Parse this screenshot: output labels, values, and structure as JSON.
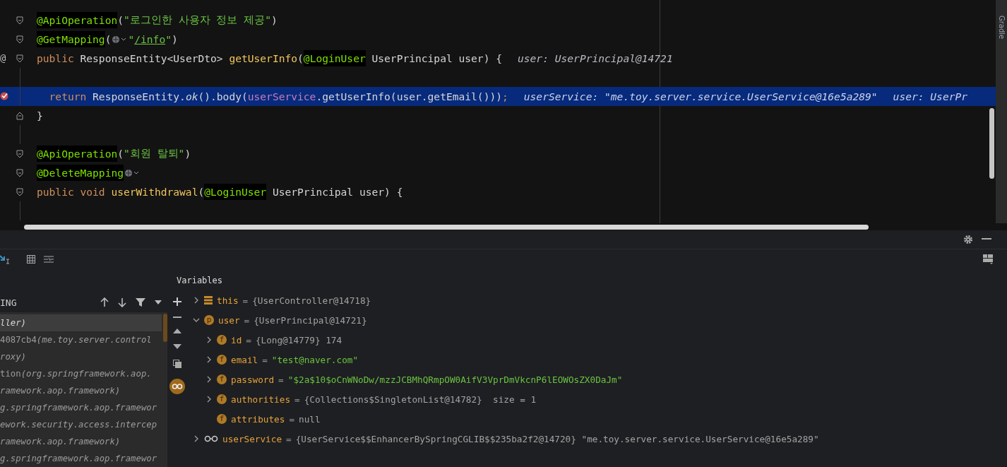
{
  "editor": {
    "lines": [
      {
        "kind": "start",
        "tokens": [
          {
            "kind": "annotation",
            "text": "@ApiOperation"
          },
          {
            "kind": "plain",
            "text": "("
          },
          {
            "kind": "string",
            "text": "\"로그인한 사용자 정보 제공\""
          },
          {
            "kind": "plain",
            "text": ")"
          }
        ]
      },
      {
        "kind": "start",
        "tokens": [
          {
            "kind": "annotation",
            "text": "@GetMapping"
          },
          {
            "kind": "plain",
            "text": "("
          },
          {
            "kind": "globe"
          },
          {
            "kind": "string",
            "text": "\""
          },
          {
            "kind": "link",
            "text": "/info"
          },
          {
            "kind": "string",
            "text": "\""
          },
          {
            "kind": "plain",
            "text": ")"
          }
        ]
      },
      {
        "kind": "start",
        "gutter_text": "@",
        "tokens": [
          {
            "kind": "keyword",
            "text": "public "
          },
          {
            "kind": "plain",
            "text": "ResponseEntity<UserDto> "
          },
          {
            "kind": "method",
            "text": "getUserInfo"
          },
          {
            "kind": "plain",
            "text": "("
          },
          {
            "kind": "annotation",
            "text": "@LoginUser"
          },
          {
            "kind": "plain",
            "text": " UserPrincipal user) {"
          },
          {
            "kind": "hint",
            "text": "user: UserPrincipal@14721"
          }
        ]
      },
      {
        "kind": "body"
      },
      {
        "kind": "body",
        "current": true,
        "breakpoint": true,
        "tokens": [
          {
            "kind": "keyword",
            "text": "  return "
          },
          {
            "kind": "plain",
            "text": "ResponseEntity."
          },
          {
            "kind": "static",
            "text": "ok"
          },
          {
            "kind": "plain",
            "text": "().body("
          },
          {
            "kind": "field",
            "text": "userService"
          },
          {
            "kind": "plain",
            "text": ".getUserInfo(user.getEmail()))"
          },
          {
            "kind": "semicolon",
            "text": ";"
          },
          {
            "kind": "hint",
            "text": "userService: \"me.toy.server.service.UserService@16e5a289\""
          },
          {
            "kind": "hint",
            "text": "user: UserPr"
          }
        ]
      },
      {
        "kind": "end",
        "tokens": [
          {
            "kind": "plain",
            "text": "}"
          }
        ]
      },
      {
        "kind": "body"
      },
      {
        "kind": "start",
        "tokens": [
          {
            "kind": "annotation",
            "text": "@ApiOperation"
          },
          {
            "kind": "plain",
            "text": "("
          },
          {
            "kind": "string",
            "text": "\"회원 탈퇴\""
          },
          {
            "kind": "plain",
            "text": ")"
          }
        ]
      },
      {
        "kind": "start",
        "tokens": [
          {
            "kind": "annotation",
            "text": "@DeleteMapping"
          },
          {
            "kind": "globe"
          }
        ]
      },
      {
        "kind": "start",
        "tokens": [
          {
            "kind": "keyword",
            "text": "public void "
          },
          {
            "kind": "method",
            "text": "userWithdrawal"
          },
          {
            "kind": "plain",
            "text": "("
          },
          {
            "kind": "annotation",
            "text": "@LoginUser"
          },
          {
            "kind": "plain",
            "text": " UserPrincipal user) {"
          }
        ]
      },
      {
        "kind": "body"
      }
    ]
  },
  "side_strip": {
    "label": "Gradle"
  },
  "frames": {
    "header": "ING",
    "items": [
      {
        "location": "ller)",
        "selected": true
      },
      {
        "name": "4087cb4",
        "location": "(me.toy.server.control",
        "selected": false
      },
      {
        "location": "roxy)",
        "selected": false
      },
      {
        "name": "tion",
        "location": "(org.springframework.aop.",
        "selected": false
      },
      {
        "location": "ramework.aop.framework)",
        "selected": false
      },
      {
        "location": "g.springframework.aop.framewor",
        "selected": false
      },
      {
        "location": "ework.security.access.intercep",
        "selected": false
      },
      {
        "location": "ramework.aop.framework)",
        "selected": false
      },
      {
        "location": "g.springframework.aop.framewor",
        "selected": false
      }
    ]
  },
  "variables": {
    "title": "Variables",
    "items": [
      {
        "kind": "object",
        "name": "this",
        "sign": "=",
        "value": "{UserController@14718}",
        "expanded": false
      },
      {
        "kind": "parameter",
        "badge": "p",
        "name": "user",
        "sign": "=",
        "value": "{UserPrincipal@14721}",
        "expanded": true,
        "children": [
          {
            "kind": "field",
            "badge": "f",
            "name": "id",
            "sign": "=",
            "value": "{Long@14779} 174",
            "expanded": false
          },
          {
            "kind": "field",
            "badge": "f",
            "name": "email",
            "sign": "=",
            "value": "\"test@naver.com\"",
            "string": true,
            "expanded": false
          },
          {
            "kind": "field",
            "badge": "f",
            "name": "password",
            "sign": "=",
            "value": "\"$2a$10$oCnWNoDw/mzzJCBMhQRmpOW0AifV3VprDmVkcnP6lEOWOsZX0DaJm\"",
            "string": true,
            "expanded": false
          },
          {
            "kind": "field",
            "badge": "f",
            "name": "authorities",
            "sign": "=",
            "value": "{Collections$SingletonList@14782}  size = 1",
            "expanded": false
          },
          {
            "kind": "field",
            "badge": "f",
            "name": "attributes",
            "sign": "=",
            "value": "null"
          }
        ]
      },
      {
        "kind": "watch",
        "name": "userService",
        "sign": "=",
        "value": "{UserService$$EnhancerBySpringCGLIB$$235ba2f2@14720} \"me.toy.server.service.UserService@16e5a289\"",
        "expanded": false
      }
    ]
  }
}
